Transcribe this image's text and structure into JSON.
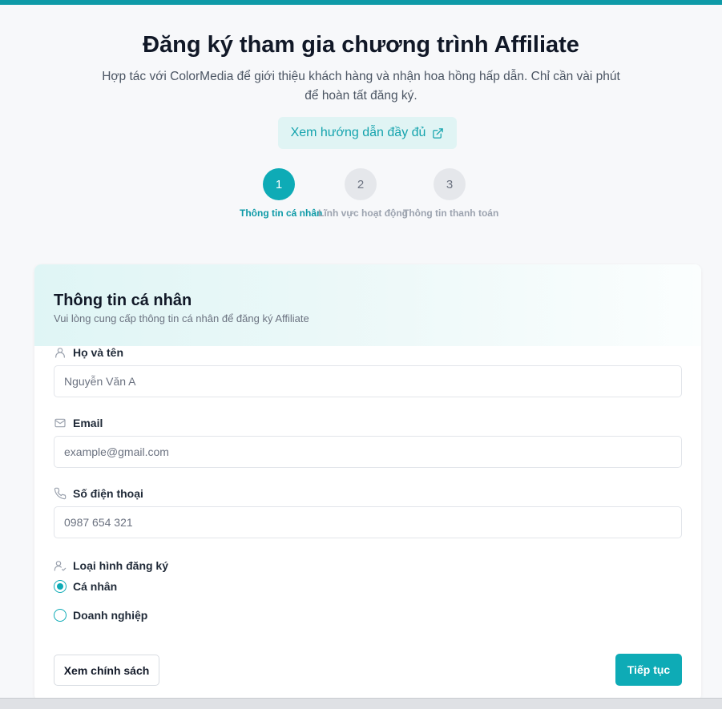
{
  "header": {
    "title": "Đăng ký tham gia chương trình Affiliate",
    "subtitle": "Hợp tác với ColorMedia để giới thiệu khách hàng và nhận hoa hồng hấp dẫn. Chỉ cần vài phút để hoàn tất đăng ký.",
    "guide_button": "Xem hướng dẫn đầy đủ",
    "guide_icon": "external-link-icon"
  },
  "steps": [
    {
      "number": "1",
      "label": "Thông tin cá nhân",
      "active": true
    },
    {
      "number": "2",
      "label": "Lĩnh vực hoạt động",
      "active": false
    },
    {
      "number": "3",
      "label": "Thông tin thanh toán",
      "active": false
    }
  ],
  "card": {
    "title": "Thông tin cá nhân",
    "subtitle": "Vui lòng cung cấp thông tin cá nhân để đăng ký Affiliate"
  },
  "form": {
    "name": {
      "label": "Họ và tên",
      "placeholder": "Nguyễn Văn A",
      "icon": "user-icon"
    },
    "email": {
      "label": "Email",
      "placeholder": "example@gmail.com",
      "icon": "mail-icon"
    },
    "phone": {
      "label": "Số điện thoại",
      "placeholder": "0987 654 321",
      "icon": "phone-icon"
    },
    "type": {
      "label": "Loại hình đăng ký",
      "icon": "user-check-icon",
      "options": [
        "Cá nhân",
        "Doanh nghiệp"
      ],
      "selected": "Cá nhân"
    }
  },
  "actions": {
    "policy": "Xem chính sách",
    "next": "Tiếp tục"
  },
  "colors": {
    "accent": "#0eabb6",
    "accent_light": "#e0f4f4",
    "top_bar": "#0e9aa7"
  }
}
